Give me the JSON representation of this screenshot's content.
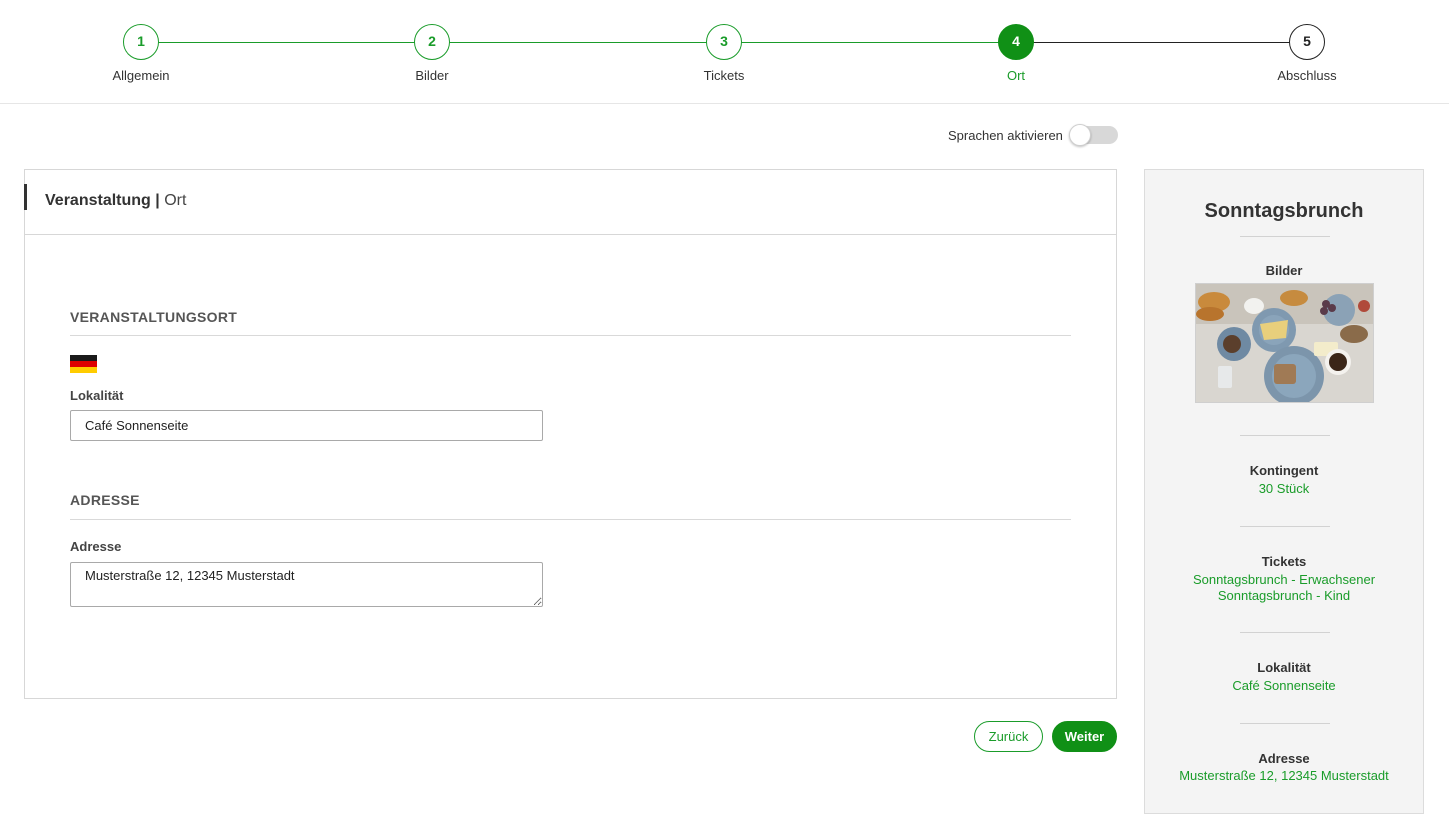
{
  "stepper": {
    "steps": [
      {
        "number": "1",
        "label": "Allgemein",
        "state": "done"
      },
      {
        "number": "2",
        "label": "Bilder",
        "state": "done"
      },
      {
        "number": "3",
        "label": "Tickets",
        "state": "done"
      },
      {
        "number": "4",
        "label": "Ort",
        "state": "active"
      },
      {
        "number": "5",
        "label": "Abschluss",
        "state": "pending"
      }
    ]
  },
  "language_toggle": {
    "label": "Sprachen aktivieren",
    "enabled": false
  },
  "card": {
    "title_bold": "Veranstaltung",
    "title_separator": "|",
    "title_sub": "Ort",
    "venue_section": {
      "title": "VERANSTALTUNGSORT",
      "flag_icon": "german-flag-icon",
      "locality_label": "Lokalität",
      "locality_value": "Café Sonnenseite"
    },
    "address_section": {
      "title": "ADRESSE",
      "address_label": "Adresse",
      "address_value": "Musterstraße 12, 12345 Musterstadt"
    }
  },
  "buttons": {
    "back_label": "Zurück",
    "next_label": "Weiter"
  },
  "summary": {
    "title": "Sonntagsbrunch",
    "images_label": "Bilder",
    "image_icon": "brunch-photo",
    "quota_label": "Kontingent",
    "quota_value": "30 Stück",
    "tickets_label": "Tickets",
    "tickets": [
      "Sonntagsbrunch - Erwachsener",
      "Sonntagsbrunch - Kind"
    ],
    "locality_label": "Lokalität",
    "locality_value": "Café Sonnenseite",
    "address_label": "Adresse",
    "address_value": "Musterstraße 12, 12345 Musterstadt"
  },
  "colors": {
    "accent_green": "#1a9c2a",
    "button_green": "#109016",
    "text_dark": "#333333",
    "border": "#d7d7d7",
    "sidebar_bg": "#f4f4f4"
  }
}
